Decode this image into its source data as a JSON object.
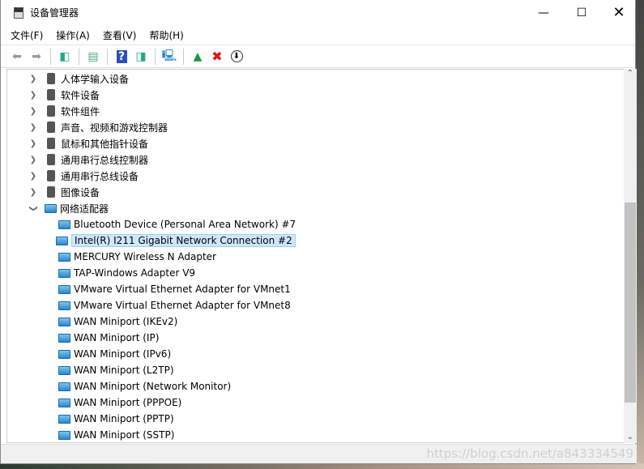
{
  "window": {
    "title": "设备管理器",
    "icon": "device-manager-icon"
  },
  "menu": [
    "文件(F)",
    "操作(A)",
    "查看(V)",
    "帮助(H)"
  ],
  "toolbar": [
    "back-icon",
    "forward-icon",
    "show-hide-console-tree-icon",
    "properties-icon",
    "help-icon",
    "action-pane-icon",
    "scan-hardware-icon",
    "update-driver-icon",
    "uninstall-icon",
    "disable-icon"
  ],
  "tree": {
    "categories": [
      {
        "label": "人体学输入设备",
        "icon": "hid-icon"
      },
      {
        "label": "软件设备",
        "icon": "software-device-icon"
      },
      {
        "label": "软件组件",
        "icon": "software-component-icon"
      },
      {
        "label": "声音、视频和游戏控制器",
        "icon": "speaker-icon"
      },
      {
        "label": "鼠标和其他指针设备",
        "icon": "mouse-icon"
      },
      {
        "label": "通用串行总线控制器",
        "icon": "usb-icon"
      },
      {
        "label": "通用串行总线设备",
        "icon": "usb-icon"
      },
      {
        "label": "图像设备",
        "icon": "camera-icon"
      }
    ],
    "expanded": {
      "label": "网络适配器",
      "icon": "network-adapter-icon",
      "children": [
        "Bluetooth Device (Personal Area Network) #7",
        "Intel(R) I211 Gigabit Network Connection #2",
        "MERCURY Wireless N Adapter",
        "TAP-Windows Adapter V9",
        "VMware Virtual Ethernet Adapter for VMnet1",
        "VMware Virtual Ethernet Adapter for VMnet8",
        "WAN Miniport (IKEv2)",
        "WAN Miniport (IP)",
        "WAN Miniport (IPv6)",
        "WAN Miniport (L2TP)",
        "WAN Miniport (Network Monitor)",
        "WAN Miniport (PPPOE)",
        "WAN Miniport (PPTP)",
        "WAN Miniport (SSTP)"
      ],
      "selected_index": 1
    }
  },
  "watermark": "https://blog.csdn.net/a843334549"
}
